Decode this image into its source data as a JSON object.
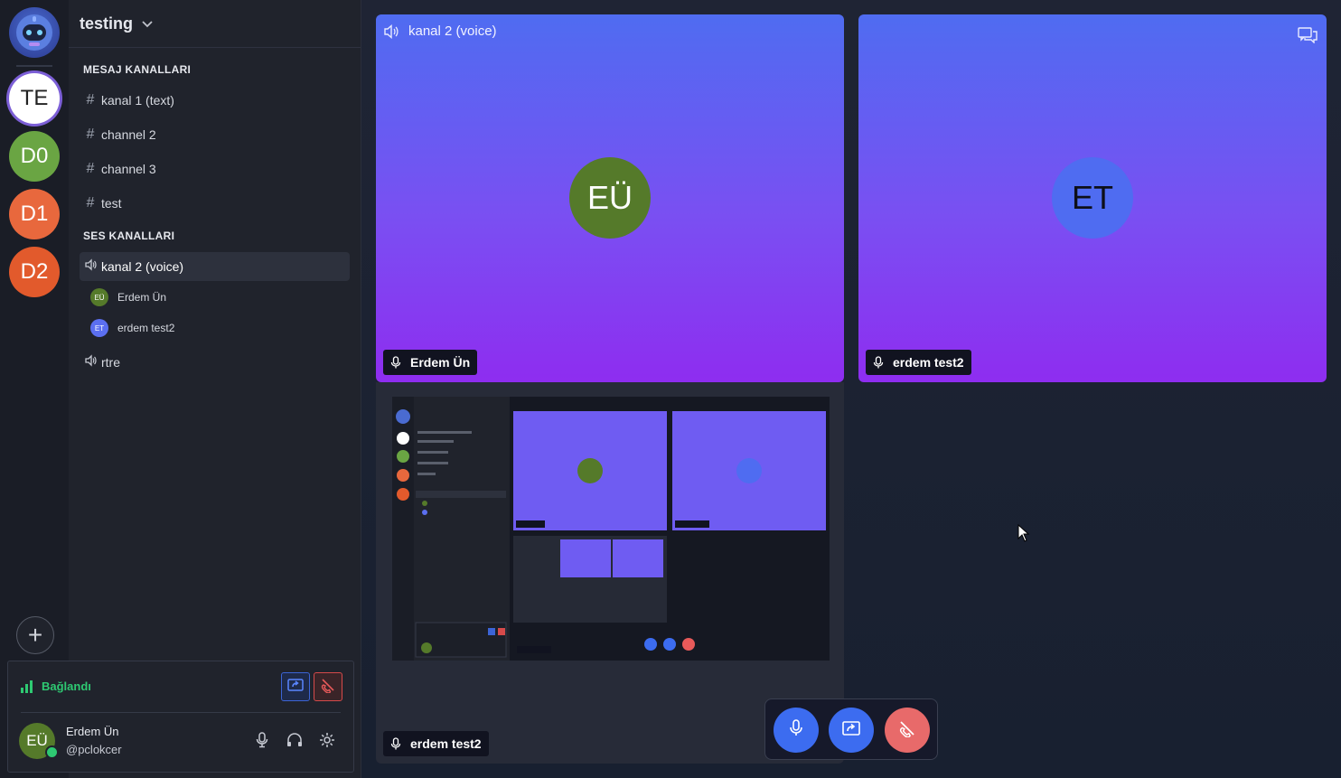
{
  "servers": [
    {
      "initials": "TE",
      "active": true
    },
    {
      "initials": "D0",
      "color": "#6aa543"
    },
    {
      "initials": "D1",
      "color": "#e8683d"
    },
    {
      "initials": "D2",
      "color": "#e25a2c"
    }
  ],
  "server_name": "testing",
  "sections": {
    "text": "MESAJ KANALLARI",
    "voice": "SES KANALLARI"
  },
  "text_channels": [
    "kanal 1 (text)",
    "channel 2",
    "channel 3",
    "test"
  ],
  "voice_channels": [
    {
      "name": "kanal 2 (voice)",
      "active": true,
      "users": [
        {
          "initials": "EÜ",
          "name": "Erdem Ün",
          "color": "#557a2a"
        },
        {
          "initials": "ET",
          "name": "erdem test2",
          "color": "#5b6ff0"
        }
      ]
    },
    {
      "name": "rtre"
    }
  ],
  "connection": {
    "status": "Bağlandı",
    "status_color": "#2ec972"
  },
  "current_user": {
    "initials": "EÜ",
    "name": "Erdem Ün",
    "handle": "@pclokcer"
  },
  "stage": {
    "channel_title": "kanal 2 (voice)",
    "tiles": [
      {
        "initials": "EÜ",
        "name": "Erdem Ün",
        "avatar_color": "#557a2a"
      },
      {
        "initials": "ET",
        "name": "erdem test2",
        "avatar_color": "#4f6cf1"
      },
      {
        "name": "erdem test2",
        "type": "screen-share"
      }
    ]
  },
  "colors": {
    "accent": "#3c64d6",
    "danger": "#e85a5a",
    "tile_gradient_top": "#4f6cf1",
    "tile_gradient_bottom": "#8e2df0"
  }
}
